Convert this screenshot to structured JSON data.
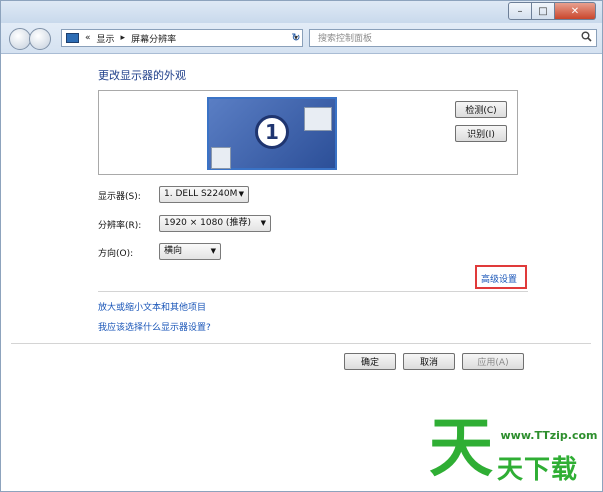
{
  "window": {
    "controls": {
      "minimize": "–",
      "maximize": "□",
      "close": "✕"
    }
  },
  "nav": {
    "breadcrumb_prefix": "«",
    "crumbs": [
      "显示",
      "屏幕分辨率"
    ],
    "separator": "▸",
    "dropdown": "▾",
    "refresh": "↻",
    "search_placeholder": "搜索控制面板",
    "search_icon": "search-icon"
  },
  "content": {
    "heading": "更改显示器的外观",
    "preview": {
      "monitor_number": "1",
      "detect_button": "检测(C)",
      "identify_button": "识别(I)"
    },
    "fields": [
      {
        "label": "显示器(S):",
        "value": "1. DELL S2240M"
      },
      {
        "label": "分辨率(R):",
        "value": "1920 × 1080 (推荐)"
      },
      {
        "label": "方向(O):",
        "value": "横向"
      }
    ],
    "advanced_link": "高级设置",
    "links": [
      "放大或缩小文本和其他项目",
      "我应该选择什么显示器设置?"
    ]
  },
  "footer": {
    "ok_button": "确定",
    "cancel_button": "取消",
    "apply_button": "应用(A)"
  },
  "watermark": {
    "url": "www.TTzip.com",
    "big_char": "天",
    "text": "天下载"
  }
}
